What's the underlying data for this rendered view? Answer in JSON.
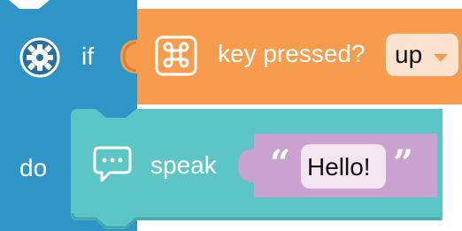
{
  "blocks": {
    "if_block": {
      "if_label": "if",
      "do_label": "do",
      "color": "#2f95c6",
      "icon": "gear-icon"
    },
    "key_pressed_block": {
      "label": "key pressed?",
      "color": "#f79c4c",
      "icon": "command-key-icon",
      "dropdown_value": "up"
    },
    "speak_block": {
      "label": "speak",
      "color": "#5cc6c6",
      "icon": "speech-bubble-icon",
      "text_color": "#c9a2cf",
      "open_quote": "“",
      "close_quote": "”",
      "text_value": "Hello!"
    }
  }
}
